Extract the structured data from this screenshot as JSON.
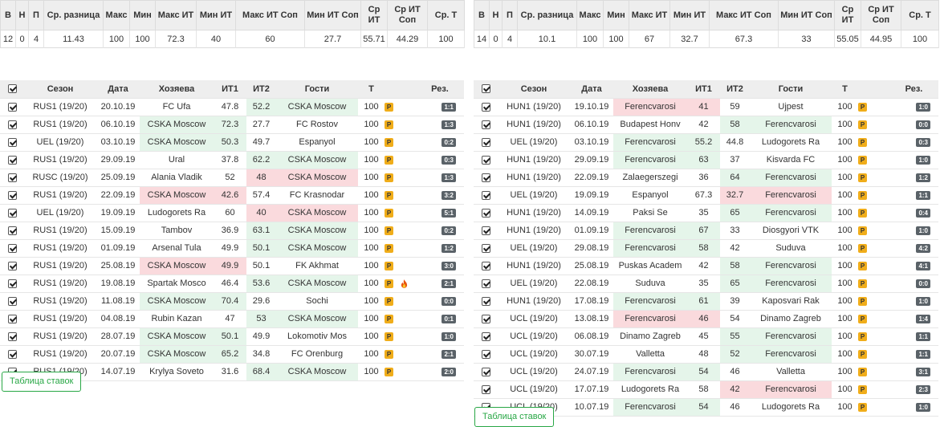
{
  "stats_headers": [
    "В",
    "Н",
    "П",
    "Ср. разница",
    "Макс",
    "Мин",
    "Макс ИТ",
    "Мин ИТ",
    "Макс ИТ Соп",
    "Мин ИТ Соп",
    "Ср ИТ",
    "Ср ИТ Соп",
    "Ср. Т"
  ],
  "match_headers": [
    "",
    "Сезон",
    "Дата",
    "Хозяева",
    "ИТ1",
    "ИТ2",
    "Гости",
    "Т",
    "",
    "",
    "Рез."
  ],
  "button_label": "Таблица ставок",
  "p_label": "P",
  "colors": {
    "green_hl": "#e5f5ea",
    "red_hl": "#fadadd",
    "badge_orange": "#f0ad1a",
    "result_badge": "#5a6268",
    "button_green": "#28a745"
  },
  "panels": [
    {
      "stats": [
        "12",
        "0",
        "4",
        "11.43",
        "100",
        "100",
        "72.3",
        "40",
        "60",
        "27.7",
        "55.71",
        "44.29",
        "100"
      ],
      "matches": [
        {
          "season": "RUS1 (19/20)",
          "date": "20.10.19",
          "home": "FC Ufa",
          "it1": "47.8",
          "it2": "52.2",
          "away": "CSKA Moscow",
          "t": "100",
          "res": "1:1",
          "hl": "away-green",
          "fire": false
        },
        {
          "season": "RUS1 (19/20)",
          "date": "06.10.19",
          "home": "CSKA Moscow",
          "it1": "72.3",
          "it2": "27.7",
          "away": "FC Rostov",
          "t": "100",
          "res": "1:3",
          "hl": "home-green",
          "fire": false
        },
        {
          "season": "UEL (19/20)",
          "date": "03.10.19",
          "home": "CSKA Moscow",
          "it1": "50.3",
          "it2": "49.7",
          "away": "Espanyol",
          "t": "100",
          "res": "0:2",
          "hl": "home-green",
          "fire": false
        },
        {
          "season": "RUS1 (19/20)",
          "date": "29.09.19",
          "home": "Ural",
          "it1": "37.8",
          "it2": "62.2",
          "away": "CSKA Moscow",
          "t": "100",
          "res": "0:3",
          "hl": "away-green",
          "fire": false
        },
        {
          "season": "RUSC (19/20)",
          "date": "25.09.19",
          "home": "Alania Vladik",
          "it1": "52",
          "it2": "48",
          "away": "CSKA Moscow",
          "t": "100",
          "res": "1:3",
          "hl": "away-red",
          "fire": false
        },
        {
          "season": "RUS1 (19/20)",
          "date": "22.09.19",
          "home": "CSKA Moscow",
          "it1": "42.6",
          "it2": "57.4",
          "away": "FC Krasnodar",
          "t": "100",
          "res": "3:2",
          "hl": "home-red",
          "fire": false
        },
        {
          "season": "UEL (19/20)",
          "date": "19.09.19",
          "home": "Ludogorets Ra",
          "it1": "60",
          "it2": "40",
          "away": "CSKA Moscow",
          "t": "100",
          "res": "5:1",
          "hl": "away-red",
          "fire": false
        },
        {
          "season": "RUS1 (19/20)",
          "date": "15.09.19",
          "home": "Tambov",
          "it1": "36.9",
          "it2": "63.1",
          "away": "CSKA Moscow",
          "t": "100",
          "res": "0:2",
          "hl": "away-green",
          "fire": false
        },
        {
          "season": "RUS1 (19/20)",
          "date": "01.09.19",
          "home": "Arsenal Tula",
          "it1": "49.9",
          "it2": "50.1",
          "away": "CSKA Moscow",
          "t": "100",
          "res": "1:2",
          "hl": "away-green",
          "fire": false
        },
        {
          "season": "RUS1 (19/20)",
          "date": "25.08.19",
          "home": "CSKA Moscow",
          "it1": "49.9",
          "it2": "50.1",
          "away": "FK Akhmat",
          "t": "100",
          "res": "3:0",
          "hl": "home-red",
          "fire": false
        },
        {
          "season": "RUS1 (19/20)",
          "date": "19.08.19",
          "home": "Spartak Mosco",
          "it1": "46.4",
          "it2": "53.6",
          "away": "CSKA Moscow",
          "t": "100",
          "res": "2:1",
          "hl": "away-green",
          "fire": true
        },
        {
          "season": "RUS1 (19/20)",
          "date": "11.08.19",
          "home": "CSKA Moscow",
          "it1": "70.4",
          "it2": "29.6",
          "away": "Sochi",
          "t": "100",
          "res": "0:0",
          "hl": "home-green",
          "fire": false
        },
        {
          "season": "RUS1 (19/20)",
          "date": "04.08.19",
          "home": "Rubin Kazan",
          "it1": "47",
          "it2": "53",
          "away": "CSKA Moscow",
          "t": "100",
          "res": "0:1",
          "hl": "away-green",
          "fire": false
        },
        {
          "season": "RUS1 (19/20)",
          "date": "28.07.19",
          "home": "CSKA Moscow",
          "it1": "50.1",
          "it2": "49.9",
          "away": "Lokomotiv Mos",
          "t": "100",
          "res": "1:0",
          "hl": "home-green",
          "fire": false
        },
        {
          "season": "RUS1 (19/20)",
          "date": "20.07.19",
          "home": "CSKA Moscow",
          "it1": "65.2",
          "it2": "34.8",
          "away": "FC Orenburg",
          "t": "100",
          "res": "2:1",
          "hl": "home-green",
          "fire": false
        },
        {
          "season": "RUS1 (19/20)",
          "date": "14.07.19",
          "home": "Krylya Soveto",
          "it1": "31.6",
          "it2": "68.4",
          "away": "CSKA Moscow",
          "t": "100",
          "res": "2:0",
          "hl": "away-green",
          "fire": false
        }
      ]
    },
    {
      "stats": [
        "14",
        "0",
        "4",
        "10.1",
        "100",
        "100",
        "67",
        "32.7",
        "67.3",
        "33",
        "55.05",
        "44.95",
        "100"
      ],
      "matches": [
        {
          "season": "HUN1 (19/20)",
          "date": "19.10.19",
          "home": "Ferencvarosi",
          "it1": "41",
          "it2": "59",
          "away": "Ujpest",
          "t": "100",
          "res": "1:0",
          "hl": "home-red",
          "fire": false
        },
        {
          "season": "HUN1 (19/20)",
          "date": "06.10.19",
          "home": "Budapest Honv",
          "it1": "42",
          "it2": "58",
          "away": "Ferencvarosi",
          "t": "100",
          "res": "0:0",
          "hl": "away-green",
          "fire": false
        },
        {
          "season": "UEL (19/20)",
          "date": "03.10.19",
          "home": "Ferencvarosi",
          "it1": "55.2",
          "it2": "44.8",
          "away": "Ludogorets Ra",
          "t": "100",
          "res": "0:3",
          "hl": "home-green",
          "fire": false
        },
        {
          "season": "HUN1 (19/20)",
          "date": "29.09.19",
          "home": "Ferencvarosi",
          "it1": "63",
          "it2": "37",
          "away": "Kisvarda FC",
          "t": "100",
          "res": "1:0",
          "hl": "home-green",
          "fire": false
        },
        {
          "season": "HUN1 (19/20)",
          "date": "22.09.19",
          "home": "Zalaegerszegi",
          "it1": "36",
          "it2": "64",
          "away": "Ferencvarosi",
          "t": "100",
          "res": "1:2",
          "hl": "away-green",
          "fire": false
        },
        {
          "season": "UEL (19/20)",
          "date": "19.09.19",
          "home": "Espanyol",
          "it1": "67.3",
          "it2": "32.7",
          "away": "Ferencvarosi",
          "t": "100",
          "res": "1:1",
          "hl": "away-red",
          "fire": false
        },
        {
          "season": "HUN1 (19/20)",
          "date": "14.09.19",
          "home": "Paksi Se",
          "it1": "35",
          "it2": "65",
          "away": "Ferencvarosi",
          "t": "100",
          "res": "0:4",
          "hl": "away-green",
          "fire": false
        },
        {
          "season": "HUN1 (19/20)",
          "date": "01.09.19",
          "home": "Ferencvarosi",
          "it1": "67",
          "it2": "33",
          "away": "Diosgyori VTK",
          "t": "100",
          "res": "1:0",
          "hl": "home-green",
          "fire": false
        },
        {
          "season": "UEL (19/20)",
          "date": "29.08.19",
          "home": "Ferencvarosi",
          "it1": "58",
          "it2": "42",
          "away": "Suduva",
          "t": "100",
          "res": "4:2",
          "hl": "home-green",
          "fire": false
        },
        {
          "season": "HUN1 (19/20)",
          "date": "25.08.19",
          "home": "Puskas Academ",
          "it1": "42",
          "it2": "58",
          "away": "Ferencvarosi",
          "t": "100",
          "res": "4:1",
          "hl": "away-green",
          "fire": false
        },
        {
          "season": "UEL (19/20)",
          "date": "22.08.19",
          "home": "Suduva",
          "it1": "35",
          "it2": "65",
          "away": "Ferencvarosi",
          "t": "100",
          "res": "0:0",
          "hl": "away-green",
          "fire": false
        },
        {
          "season": "HUN1 (19/20)",
          "date": "17.08.19",
          "home": "Ferencvarosi",
          "it1": "61",
          "it2": "39",
          "away": "Kaposvari Rak",
          "t": "100",
          "res": "1:0",
          "hl": "home-green",
          "fire": false
        },
        {
          "season": "UCL (19/20)",
          "date": "13.08.19",
          "home": "Ferencvarosi",
          "it1": "46",
          "it2": "54",
          "away": "Dinamo Zagreb",
          "t": "100",
          "res": "1:4",
          "hl": "home-red",
          "fire": false
        },
        {
          "season": "UCL (19/20)",
          "date": "06.08.19",
          "home": "Dinamo Zagreb",
          "it1": "45",
          "it2": "55",
          "away": "Ferencvarosi",
          "t": "100",
          "res": "1:1",
          "hl": "away-green",
          "fire": false
        },
        {
          "season": "UCL (19/20)",
          "date": "30.07.19",
          "home": "Valletta",
          "it1": "48",
          "it2": "52",
          "away": "Ferencvarosi",
          "t": "100",
          "res": "1:1",
          "hl": "away-green",
          "fire": false
        },
        {
          "season": "UCL (19/20)",
          "date": "24.07.19",
          "home": "Ferencvarosi",
          "it1": "54",
          "it2": "46",
          "away": "Valletta",
          "t": "100",
          "res": "3:1",
          "hl": "home-green",
          "fire": false
        },
        {
          "season": "UCL (19/20)",
          "date": "17.07.19",
          "home": "Ludogorets Ra",
          "it1": "58",
          "it2": "42",
          "away": "Ferencvarosi",
          "t": "100",
          "res": "2:3",
          "hl": "away-red",
          "fire": false
        },
        {
          "season": "UCL (19/20)",
          "date": "10.07.19",
          "home": "Ferencvarosi",
          "it1": "54",
          "it2": "46",
          "away": "Ludogorets Ra",
          "t": "100",
          "res": "1:0",
          "hl": "home-green",
          "fire": false
        }
      ]
    }
  ]
}
